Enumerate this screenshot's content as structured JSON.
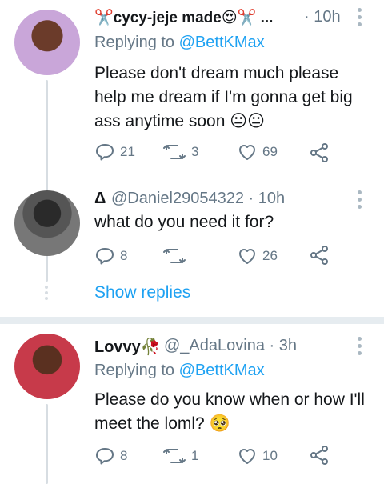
{
  "tweets": [
    {
      "name": "✂️cycy-jeje made😍✂️ ...",
      "time": "· 10h",
      "replying_prefix": "Replying to",
      "replying_handle": "@BettKMax",
      "text": "Please don't dream much please help me dream if I'm gonna get big ass anytime soon 😐😐",
      "replies": "21",
      "retweets": "3",
      "likes": "69"
    },
    {
      "name": "Δ",
      "handle": "@Daniel29054322 · 10h",
      "text": "what do you need it for?",
      "replies": "8",
      "retweets": "",
      "likes": "26"
    },
    {
      "name": "Lovvy🥀",
      "handle": "@_AdaLovina · 3h",
      "replying_prefix": "Replying to",
      "replying_handle": "@BettKMax",
      "text": "Please do you know when or how I'll meet the loml? 🥺",
      "replies": "8",
      "retweets": "1",
      "likes": "10"
    }
  ],
  "show_replies": "Show replies",
  "colors": {
    "link": "#1da1f2",
    "muted": "#657786",
    "divider": "#e6ecf0"
  }
}
